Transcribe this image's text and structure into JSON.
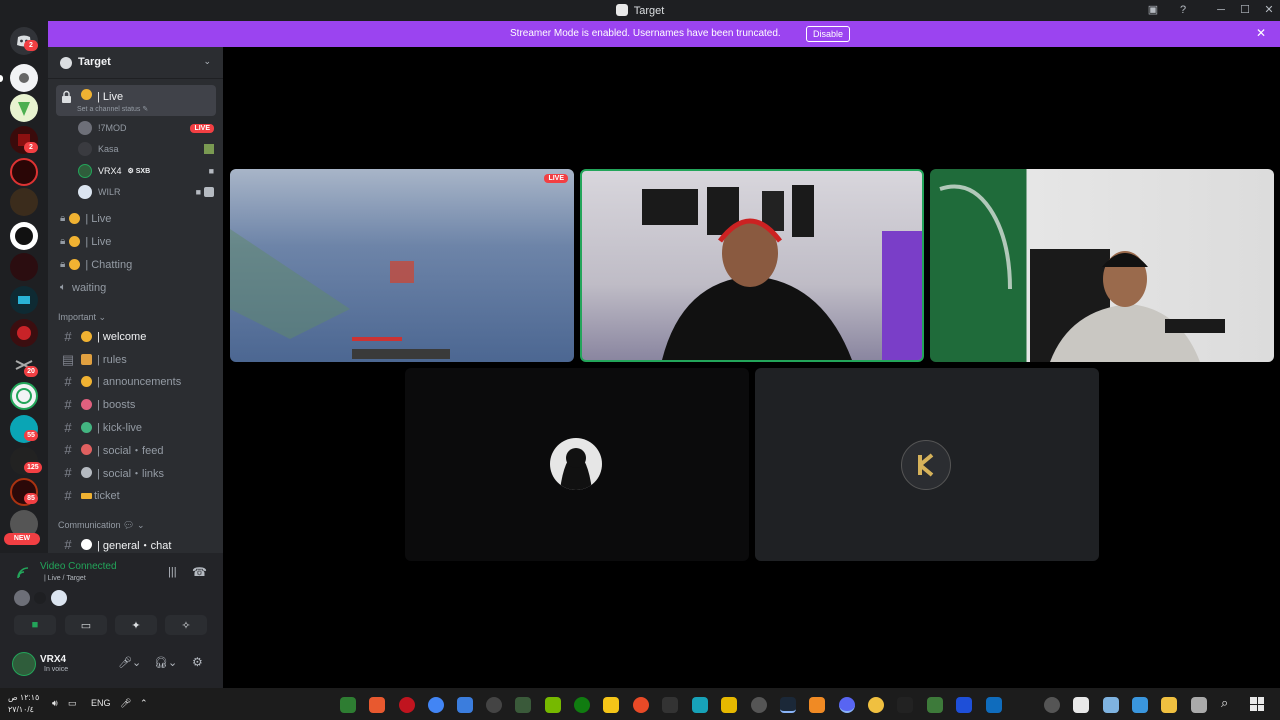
{
  "window": {
    "title": "Target"
  },
  "banner": {
    "text": "Streamer Mode is enabled. Usernames have been truncated.",
    "button": "Disable"
  },
  "guild_badges": [
    "2",
    "2",
    "20",
    "55",
    "125",
    "85"
  ],
  "guild_new_label": "NEW",
  "server": {
    "name": "Target"
  },
  "active_channel": {
    "name": "| Live",
    "status_hint": "Set a channel status",
    "users": [
      {
        "name": "!7MOD",
        "badge": "LIVE"
      },
      {
        "name": "Kasa"
      },
      {
        "name": "VRX4",
        "tag": "SXB"
      },
      {
        "name": "WILR"
      }
    ]
  },
  "voice_channels": [
    "| Live",
    "| Live",
    "| Chatting",
    "waiting"
  ],
  "categories": {
    "important": "Important",
    "communication": "Communication"
  },
  "text_channels": [
    "| welcome",
    "| rules",
    "| announcements",
    "| boosts",
    "| kick-live",
    "| social・feed",
    "| social・links",
    "ticket"
  ],
  "general_channel": "| general・chat",
  "voice_panel": {
    "status": "Video Connected",
    "location": "| Live / Target"
  },
  "user": {
    "name": "VRX4",
    "status": "In voice"
  },
  "stage": {
    "live_badge": "LIVE"
  },
  "taskbar": {
    "time": "١٢:١٥ ص",
    "date": "٢٧/١٠/٤",
    "lang": "ENG"
  },
  "colors": {
    "accent": "#9b44f0",
    "live": "#f23f43",
    "connected": "#23a55a",
    "speaking": "#23a55a"
  },
  "icons": [
    "discord-icon",
    "lock-icon",
    "pencil-icon",
    "speaker-icon",
    "hash-icon",
    "camera-icon",
    "screen-share-icon",
    "activity-icon",
    "soundboard-icon",
    "mic-icon",
    "headphones-icon",
    "gear-icon",
    "disconnect-icon",
    "signal-icon",
    "inbox-icon",
    "help-icon",
    "search-icon",
    "windows-icon"
  ]
}
